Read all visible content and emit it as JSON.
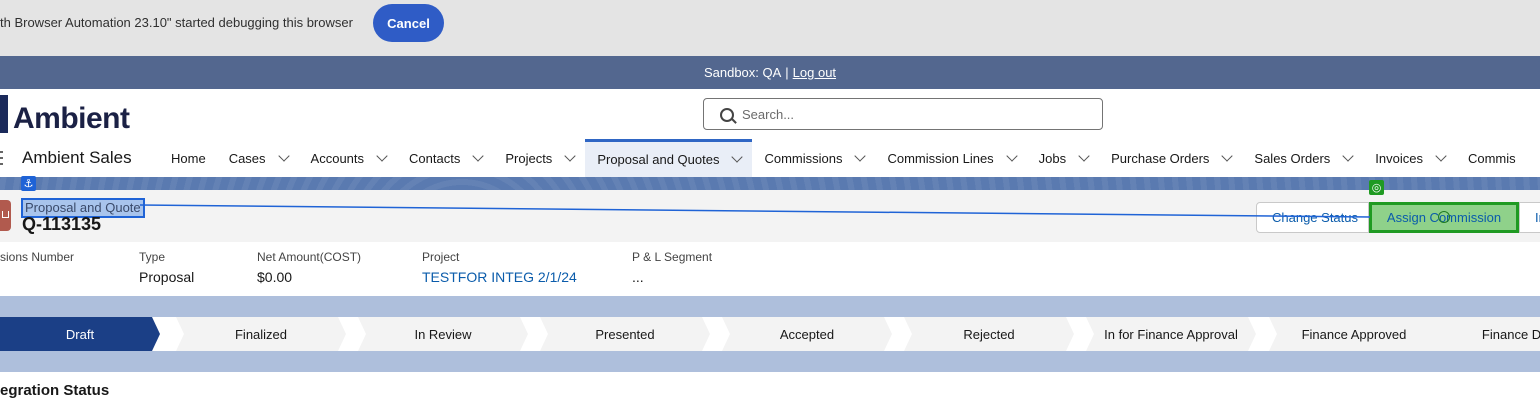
{
  "debug_banner": {
    "text": "th Browser Automation 23.10\" started debugging this browser",
    "cancel_label": "Cancel"
  },
  "sandbox": {
    "text": "Sandbox: QA",
    "separator": "|",
    "logout_label": "Log out"
  },
  "header": {
    "logo_text": "Ambient",
    "search_placeholder": "Search...",
    "app_name": "Ambient Sales"
  },
  "nav": [
    {
      "label": "Home",
      "has_menu": false
    },
    {
      "label": "Cases",
      "has_menu": true
    },
    {
      "label": "Accounts",
      "has_menu": true
    },
    {
      "label": "Contacts",
      "has_menu": true
    },
    {
      "label": "Projects",
      "has_menu": true
    },
    {
      "label": "Proposal and Quotes",
      "has_menu": true,
      "active": true
    },
    {
      "label": "Commissions",
      "has_menu": true
    },
    {
      "label": "Commission Lines",
      "has_menu": true
    },
    {
      "label": "Jobs",
      "has_menu": true
    },
    {
      "label": "Purchase Orders",
      "has_menu": true
    },
    {
      "label": "Sales Orders",
      "has_menu": true
    },
    {
      "label": "Invoices",
      "has_menu": true
    },
    {
      "label": "Commis",
      "has_menu": false
    }
  ],
  "record": {
    "object_label": "Proposal and Quote",
    "name": "Q-113135",
    "actions": {
      "change_status": "Change Status",
      "assign_commission": "Assign Commission",
      "more_label": "Ir"
    },
    "fields": [
      {
        "label": "sions Number",
        "value": ""
      },
      {
        "label": "Type",
        "value": "Proposal"
      },
      {
        "label": "Net Amount(COST)",
        "value": "$0.00"
      },
      {
        "label": "Project",
        "value": "TESTFOR INTEG 2/1/24",
        "link": true
      },
      {
        "label": "P & L Segment",
        "value": "..."
      }
    ]
  },
  "path_steps": [
    {
      "label": "Draft",
      "current": true
    },
    {
      "label": "Finalized"
    },
    {
      "label": "In Review"
    },
    {
      "label": "Presented"
    },
    {
      "label": "Accepted"
    },
    {
      "label": "Rejected"
    },
    {
      "label": "In for Finance Approval"
    },
    {
      "label": "Finance Approved"
    },
    {
      "label": "Finance Di"
    }
  ],
  "section": {
    "title": "egration Status"
  },
  "colors": {
    "brand_blue": "#1b3f86",
    "sandbox_bar": "#53678f",
    "highlight_green": "#8fd18a",
    "highlight_blue": "#a8c4ec"
  }
}
